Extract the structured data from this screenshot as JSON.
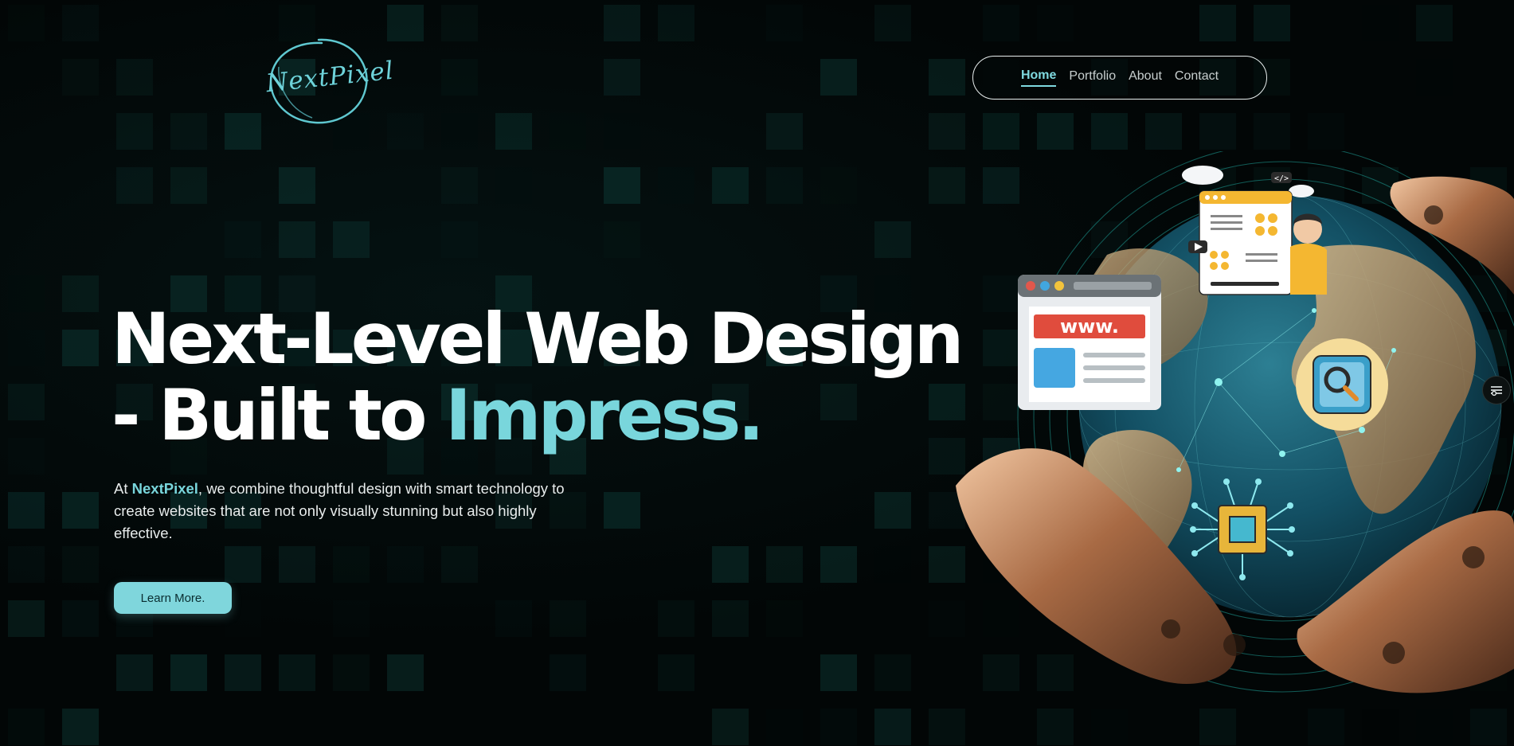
{
  "logo": {
    "text": "NextPixel"
  },
  "nav": {
    "items": [
      {
        "label": "Home",
        "active": true
      },
      {
        "label": "Portfolio",
        "active": false
      },
      {
        "label": "About",
        "active": false
      },
      {
        "label": "Contact",
        "active": false
      }
    ]
  },
  "hero": {
    "title_line1": "Next-Level Web Design",
    "title_line2_prefix": "- Built to ",
    "title_line2_accent": "Impress.",
    "desc_prefix": "At ",
    "desc_brand": "NextPixel",
    "desc_suffix": ", we combine thoughtful design with smart technology to create websites that are not only visually stunning but also highly effective.",
    "cta_label": "Learn More."
  },
  "illustration": {
    "www_label": "www.",
    "code_tag": "</>"
  },
  "colors": {
    "accent": "#79d6dc",
    "background": "#020606",
    "grid_cell": "#0d3a36"
  }
}
